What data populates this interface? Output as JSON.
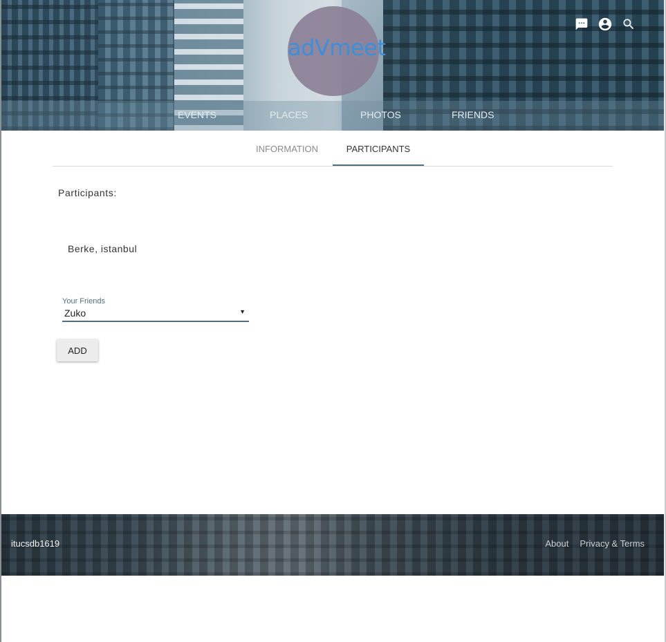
{
  "header": {
    "logo_text": "adVmeet",
    "icons": [
      "chat-icon",
      "account-circle-icon",
      "search-icon"
    ]
  },
  "nav": {
    "items": [
      {
        "label": "EVENTS"
      },
      {
        "label": "PLACES"
      },
      {
        "label": "PHOTOS"
      },
      {
        "label": "FRIENDS"
      }
    ]
  },
  "tabs": [
    {
      "label": "INFORMATION",
      "active": false
    },
    {
      "label": "PARTICIPANTS",
      "active": true
    }
  ],
  "main": {
    "section_title": "Participants:",
    "participants": [
      "Berke, istanbul"
    ],
    "friends_select": {
      "label": "Your Friends",
      "value": "Zuko"
    },
    "add_button": "ADD"
  },
  "footer": {
    "brand": "itucsdb1619",
    "links": [
      "About",
      "Privacy & Terms"
    ]
  },
  "colors": {
    "accent": "#4f6f80",
    "logo_text": "#3b8fdc",
    "logo_circle": "#8c8096"
  }
}
